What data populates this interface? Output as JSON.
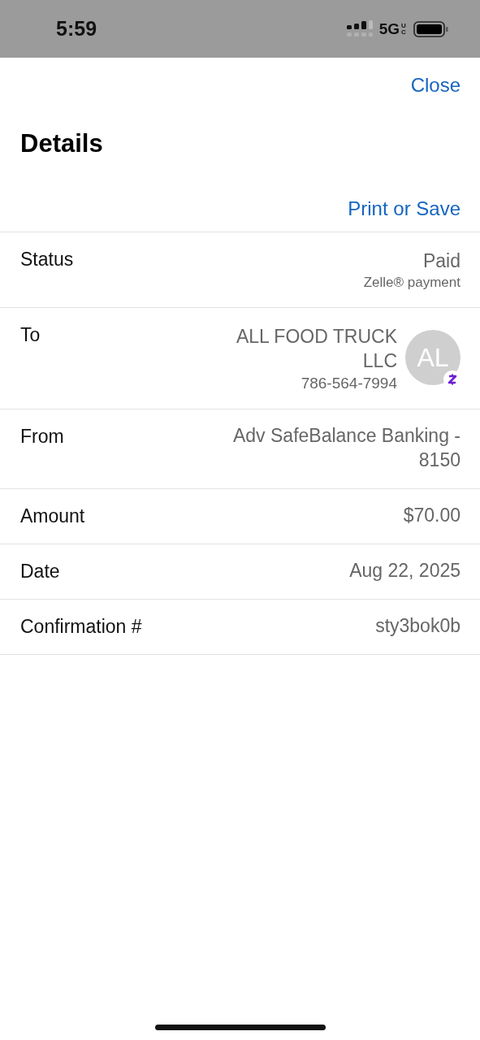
{
  "status_bar": {
    "time": "5:59",
    "network": "5G",
    "network_sub": "UC"
  },
  "header": {
    "close": "Close",
    "title": "Details",
    "print": "Print or Save"
  },
  "rows": [
    {
      "kind": "status",
      "label": "Status",
      "value": "Paid",
      "note": "Zelle® payment"
    },
    {
      "kind": "payee",
      "label": "To",
      "value": "ALL FOOD TRUCK LLC",
      "note": "786-564-7994",
      "initials": "AL"
    },
    {
      "kind": "plain",
      "label": "From",
      "value": "Adv SafeBalance Banking - 8150"
    },
    {
      "kind": "plain",
      "label": "Amount",
      "value": "$70.00"
    },
    {
      "kind": "plain",
      "label": "Date",
      "value": "Aug 22, 2025"
    },
    {
      "kind": "plain",
      "label": "Confirmation #",
      "value": "sty3bok0b"
    }
  ]
}
